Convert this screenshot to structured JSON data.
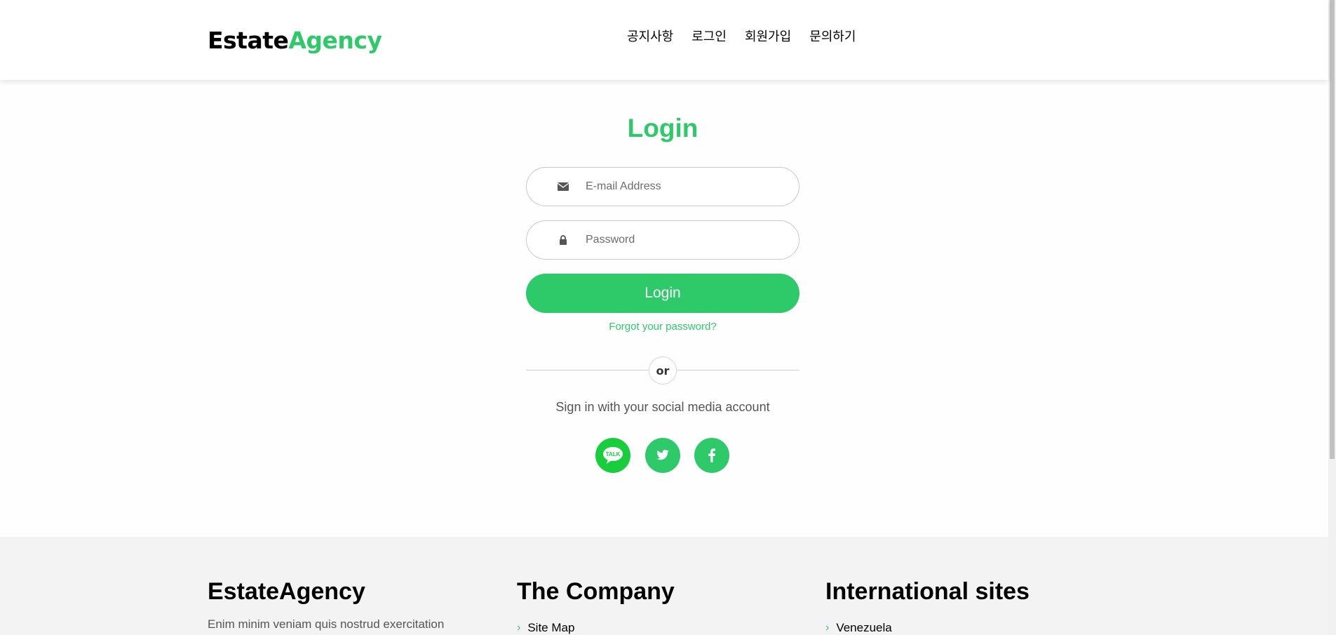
{
  "brand": {
    "part1": "Estate",
    "part2": "Agency"
  },
  "nav": {
    "items": [
      "공지사항",
      "로그인",
      "회원가입",
      "문의하기"
    ]
  },
  "login": {
    "title": "Login",
    "email_placeholder": "E-mail Address",
    "password_placeholder": "Password",
    "button_label": "Login",
    "forgot_label": "Forgot your password?",
    "or_label": "or",
    "social_text": "Sign in with your social media account",
    "kakao_label": "TALK"
  },
  "footer": {
    "col1": {
      "title": "EstateAgency",
      "text": "Enim minim veniam quis nostrud exercitation"
    },
    "col2": {
      "title": "The Company",
      "link": "Site Map"
    },
    "col3": {
      "title": "International sites",
      "link": "Venezuela"
    }
  },
  "colors": {
    "accent": "#2eca6a",
    "kakao": "#19ce3c"
  }
}
